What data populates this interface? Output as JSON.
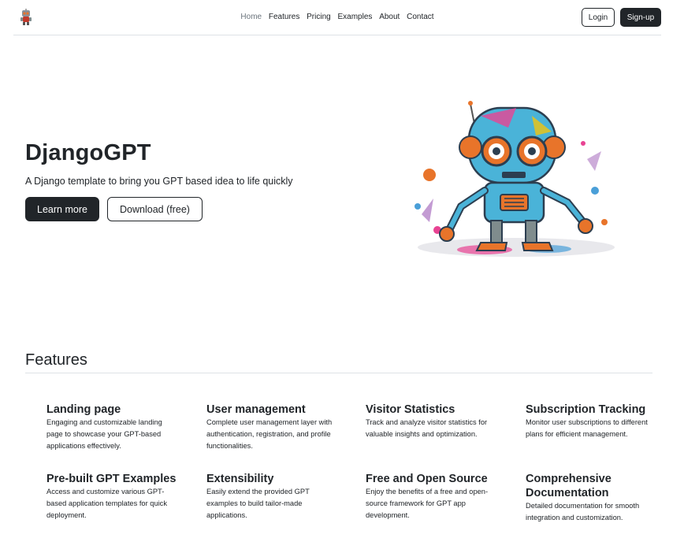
{
  "nav": {
    "links": [
      "Home",
      "Features",
      "Pricing",
      "Examples",
      "About",
      "Contact"
    ],
    "login_label": "Login",
    "signup_label": "Sign-up"
  },
  "hero": {
    "title": "DjangoGPT",
    "subtitle": "A Django template to bring you GPT based idea to life quickly",
    "learn_more_label": "Learn more",
    "download_label": "Download (free)"
  },
  "features": {
    "heading": "Features",
    "items": [
      {
        "title": "Landing page",
        "desc": "Engaging and customizable landing page to showcase your GPT-based applications effectively."
      },
      {
        "title": "User management",
        "desc": "Complete user management layer with authentication, registration, and profile functionalities."
      },
      {
        "title": "Visitor Statistics",
        "desc": "Track and analyze visitor statistics for valuable insights and optimization."
      },
      {
        "title": "Subscription Tracking",
        "desc": "Monitor user subscriptions to different plans for efficient management."
      },
      {
        "title": "Pre-built GPT Examples",
        "desc": "Access and customize various GPT-based application templates for quick deployment."
      },
      {
        "title": "Extensibility",
        "desc": "Easily extend the provided GPT examples to build tailor-made applications."
      },
      {
        "title": "Free and Open Source",
        "desc": "Enjoy the benefits of a free and open-source framework for GPT app development."
      },
      {
        "title": "Comprehensive Documentation",
        "desc": "Detailed documentation for smooth integration and customization."
      }
    ]
  },
  "colors": {
    "dark": "#212529",
    "muted": "#6c757d",
    "border": "#dee2e6"
  }
}
